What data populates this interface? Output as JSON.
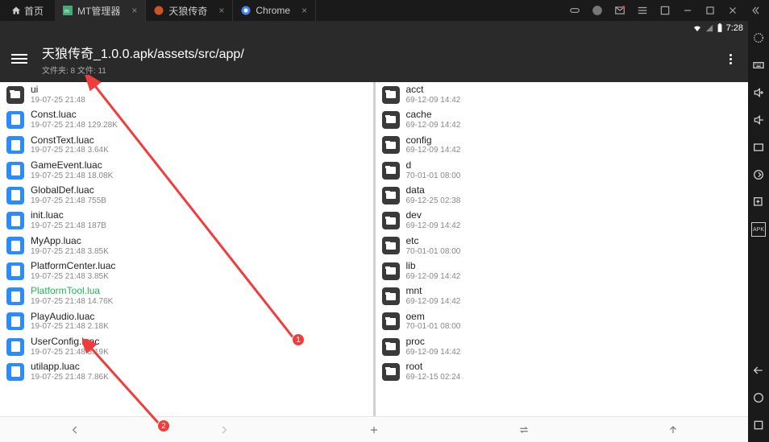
{
  "tabs": {
    "home": "首页",
    "items": [
      {
        "label": "MT管理器",
        "active": true
      },
      {
        "label": "天狼传奇",
        "active": false
      },
      {
        "label": "Chrome",
        "active": false
      }
    ]
  },
  "status": {
    "time": "7:28"
  },
  "header": {
    "path": "天狼传奇_1.0.0.apk/assets/src/app/",
    "sub": "文件夹: 8 文件: 11"
  },
  "left_pane": [
    {
      "type": "folder",
      "name": "ui",
      "meta": "19-07-25 21:48"
    },
    {
      "type": "file",
      "name": "Const.luac",
      "meta": "19-07-25 21:48  129.28K"
    },
    {
      "type": "file",
      "name": "ConstText.luac",
      "meta": "19-07-25 21:48  3.64K"
    },
    {
      "type": "file",
      "name": "GameEvent.luac",
      "meta": "19-07-25 21:48  18.08K"
    },
    {
      "type": "file",
      "name": "GlobalDef.luac",
      "meta": "19-07-25 21:48  755B"
    },
    {
      "type": "file",
      "name": "init.luac",
      "meta": "19-07-25 21:48  187B"
    },
    {
      "type": "file",
      "name": "MyApp.luac",
      "meta": "19-07-25 21:48  3.85K"
    },
    {
      "type": "file",
      "name": "PlatformCenter.luac",
      "meta": "19-07-25 21:48  3.85K"
    },
    {
      "type": "file",
      "name": "PlatformTool.lua",
      "meta": "19-07-25 21:48  14.76K",
      "highlight": true
    },
    {
      "type": "file",
      "name": "PlayAudio.luac",
      "meta": "19-07-25 21:48  2.18K"
    },
    {
      "type": "file",
      "name": "UserConfig.luac",
      "meta": "19-07-25 21:48  3.19K"
    },
    {
      "type": "file",
      "name": "utilapp.luac",
      "meta": "19-07-25 21:48  7.86K"
    }
  ],
  "right_pane": [
    {
      "type": "folder",
      "name": "acct",
      "meta": "69-12-09 14:42"
    },
    {
      "type": "folder",
      "name": "cache",
      "meta": "69-12-09 14:42"
    },
    {
      "type": "folder",
      "name": "config",
      "meta": "69-12-09 14:42"
    },
    {
      "type": "folder",
      "name": "d",
      "meta": "70-01-01 08:00"
    },
    {
      "type": "folder",
      "name": "data",
      "meta": "69-12-25 02:38"
    },
    {
      "type": "folder",
      "name": "dev",
      "meta": "69-12-09 14:42"
    },
    {
      "type": "folder",
      "name": "etc",
      "meta": "70-01-01 08:00"
    },
    {
      "type": "folder",
      "name": "lib",
      "meta": "69-12-09 14:42"
    },
    {
      "type": "folder",
      "name": "mnt",
      "meta": "69-12-09 14:42"
    },
    {
      "type": "folder",
      "name": "oem",
      "meta": "70-01-01 08:00"
    },
    {
      "type": "folder",
      "name": "proc",
      "meta": "69-12-09 14:42"
    },
    {
      "type": "folder",
      "name": "root",
      "meta": "69-12-15 02:24"
    }
  ],
  "annotations": {
    "badge1": "1",
    "badge2": "2"
  }
}
